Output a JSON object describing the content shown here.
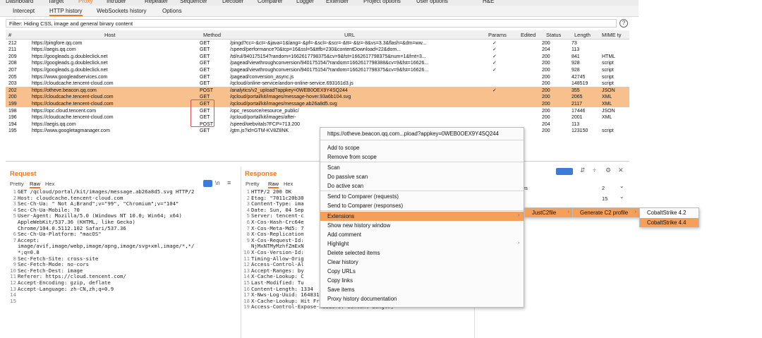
{
  "top_menu": [
    "Dashboard",
    "Target",
    "Proxy",
    "Intruder",
    "Repeater",
    "Sequencer",
    "Decoder",
    "Comparer",
    "Logger",
    "Extender",
    "Project options",
    "User options",
    "H&E"
  ],
  "sub_tabs": [
    "Intercept",
    "HTTP history",
    "WebSockets history",
    "Options"
  ],
  "filter_text": "Filter: Hiding CSS, image and general binary content",
  "help_glyph": "?",
  "columns": [
    "#",
    "Host",
    "Method",
    "URL",
    "Params",
    "Edited",
    "Status",
    "Length",
    "MIME ty"
  ],
  "rows": [
    {
      "n": "212",
      "host": "https://pingfore.qq.com",
      "method": "GET",
      "url": "/pingd?cc=-&ct=-&java=1&lang=-&pf=-&scl=-&scr=-&tt=-&tz=-8&vs=3.3&flash=&dm=ww...",
      "params": "✓",
      "status": "200",
      "length": "73",
      "mime": "",
      "hl": false
    },
    {
      "n": "211",
      "host": "https://aegis.qq.com",
      "method": "GET",
      "url": "/speed/performance?0&tcp=16&ssl=5&ttfb=230&contentDownload=22&dom...",
      "params": "✓",
      "status": "204",
      "length": "113",
      "mime": "",
      "hl": false
    },
    {
      "n": "209",
      "host": "https://googleads.g.doubleclick.net",
      "method": "GET",
      "url": "/td/rul/940175154?random=1662617798375&cv=9&fst=1662617798375&num=1&fmt=3...",
      "params": "✓",
      "status": "200",
      "length": "841",
      "mime": "HTML",
      "hl": false
    },
    {
      "n": "208",
      "host": "https://googleads.g.doubleclick.net",
      "method": "GET",
      "url": "/pagead/viewthroughconversion/940175154/?random=1662617798388&cv=9&fst=16626...",
      "params": "✓",
      "status": "200",
      "length": "928",
      "mime": "script",
      "hl": false
    },
    {
      "n": "207",
      "host": "https://googleads.g.doubleclick.net",
      "method": "GET",
      "url": "/pagead/viewthroughconversion/940175154/?random=1662617798375&cv=9&fst=16626...",
      "params": "✓",
      "status": "200",
      "length": "928",
      "mime": "script",
      "hl": false
    },
    {
      "n": "205",
      "host": "https://www.googleadservices.com",
      "method": "GET",
      "url": "/pagead/conversion_async.js",
      "params": "",
      "status": "200",
      "length": "42745",
      "mime": "script",
      "hl": false
    },
    {
      "n": "203",
      "host": "https://cloudcache.tencent-cloud.com",
      "method": "GET",
      "url": "/qcloud/online-service/andon-online-service.693161d3.js",
      "params": "",
      "status": "200",
      "length": "148519",
      "mime": "script",
      "hl": false
    },
    {
      "n": "202",
      "host": "https://otheve.beacon.qq.com",
      "method": "POST",
      "url": "/analytics/v2_upload?appkey=0WEB0OEX9Y4SQ244",
      "params": "✓",
      "status": "200",
      "length": "355",
      "mime": "JSON",
      "hl": true
    },
    {
      "n": "200",
      "host": "https://cloudcache.tencent-cloud.com",
      "method": "GET",
      "url": "/qcloud/portal/kit/images/message-hover.93a6b104.svg",
      "params": "",
      "status": "200",
      "length": "2065",
      "mime": "XML",
      "hl": true
    },
    {
      "n": "199",
      "host": "https://cloudcache.tencent-cloud.com",
      "method": "GET",
      "url": "/qcloud/portal/kit/images/message.ab26a8d5.svg",
      "params": "",
      "status": "200",
      "length": "2117",
      "mime": "XML",
      "hl": true
    },
    {
      "n": "198",
      "host": "https://opc.cloud.tencent.com",
      "method": "GET",
      "url": "/opc_resource/resource_public/",
      "params": "",
      "status": "200",
      "length": "17446",
      "mime": "JSON",
      "hl": false
    },
    {
      "n": "196",
      "host": "https://cloudcache.tencent-cloud.com",
      "method": "GET",
      "url": "/qcloud/portal/kit/images/after-",
      "params": "",
      "status": "200",
      "length": "2001",
      "mime": "XML",
      "hl": false
    },
    {
      "n": "194",
      "host": "https://aegis.qq.com",
      "method": "POST",
      "url": "/speed/webvitals?FCP=713.200",
      "params": "",
      "status": "204",
      "length": "113",
      "mime": "",
      "hl": false
    },
    {
      "n": "195",
      "host": "https://www.googletagmanager.com",
      "method": "GET",
      "url": "/gtm.js?id=GTM-KV8Z8NK",
      "params": "",
      "status": "200",
      "length": "123150",
      "mime": "script",
      "hl": false
    }
  ],
  "request": {
    "title": "Request",
    "tabs": [
      "Pretty",
      "Raw",
      "Hex"
    ],
    "toolbar": [
      "\\n",
      "≡"
    ],
    "lines": [
      [
        "1",
        "GET /qcloud/portal/kit/images/message.ab26a8d5.svg HTTP/2"
      ],
      [
        "2",
        "Host: cloudcache.tencent-cloud.com"
      ],
      [
        "3",
        "Sec-Ch-Ua: \" Not A;Brand\";v=\"99\", \"Chromium\";v=\"104\""
      ],
      [
        "4",
        "Sec-Ch-Ua-Mobile: ?0"
      ],
      [
        "5",
        "User-Agent: Mozilla/5.0 (Windows NT 10.0; Win64; x64)"
      ],
      [
        "",
        "AppleWebKit/537.36 (KHTML, like Gecko)"
      ],
      [
        "",
        "Chrome/104.0.5112.102 Safari/537.36"
      ],
      [
        "6",
        "Sec-Ch-Ua-Platform: \"macOS\""
      ],
      [
        "7",
        "Accept:"
      ],
      [
        "",
        "image/avif,image/webp,image/apng,image/svg+xml,image/*,*/"
      ],
      [
        "",
        "*;q=0.8"
      ],
      [
        "8",
        "Sec-Fetch-Site: cross-site"
      ],
      [
        "9",
        "Sec-Fetch-Mode: no-cors"
      ],
      [
        "10",
        "Sec-Fetch-Dest: image"
      ],
      [
        "11",
        "Referer: https://cloud.tencent.com/"
      ],
      [
        "12",
        "Accept-Encoding: gzip, deflate"
      ],
      [
        "13",
        "Accept-Language: zh-CN,zh;q=0.9"
      ],
      [
        "14",
        ""
      ],
      [
        "15",
        ""
      ]
    ]
  },
  "response": {
    "title": "Response",
    "tabs": [
      "Pretty",
      "Raw",
      "Hex"
    ],
    "lines": [
      [
        "1",
        "HTTP/2 200 OK"
      ],
      [
        "2",
        "Etag: \"7011c20b30"
      ],
      [
        "3",
        "Content-Type: ima"
      ],
      [
        "4",
        "Date: Sun, 04 Sep"
      ],
      [
        "5",
        "Server: tencent-c"
      ],
      [
        "6",
        "X-Cos-Hash-Crc64e"
      ],
      [
        "7",
        "X-Cos-Meta-Md5: 7"
      ],
      [
        "8",
        "X-Cos-Replication"
      ],
      [
        "9",
        "X-Cos-Request-Id:"
      ],
      [
        "",
        "NjMxNTMyMzhfZmExN"
      ],
      [
        "10",
        "X-Cos-Version-Id:"
      ],
      [
        "11",
        "Timing-Allow-Orig"
      ],
      [
        "12",
        "Access-Control-Al"
      ],
      [
        "13",
        "Accept-Ranges: by"
      ],
      [
        "14",
        "X-Cache-Lookup: C"
      ],
      [
        "15",
        "Last-Modified: Tu"
      ],
      [
        "16",
        "Content-Length: 1334"
      ],
      [
        "17",
        "X-Nws-Log-Uuid: 16483175132883555382"
      ],
      [
        "18",
        "X-Cache-Lookup: Hit From Inner Cluster"
      ],
      [
        "19",
        "Access-Control-Expose-Headers: Content-Length,"
      ]
    ]
  },
  "inspector": {
    "items": [
      {
        "label": "es",
        "count": "2"
      },
      {
        "label": "",
        "count": "15"
      },
      {
        "label": "ers",
        "count": "19"
      }
    ],
    "icons": [
      "⊞",
      "☰",
      "⚙",
      "✕"
    ]
  },
  "context_menu": {
    "header": "https://otheve.beacon.qq.com...pload?appkey=0WEB0OEX9Y4SQ244",
    "items": [
      "Add to scope",
      "Remove from scope",
      "Scan",
      "Do passive scan",
      "Do active scan",
      "Send to Comparer (requests)",
      "Send to Comparer (responses)",
      "Extensions",
      "Show new history window",
      "Add comment",
      "Highlight",
      "Delete selected items",
      "Clear history",
      "Copy URLs",
      "Copy links",
      "Save items",
      "Proxy history documentation"
    ],
    "submenu1": [
      "JustC2file"
    ],
    "submenu2": [
      "Generate C2 profile"
    ],
    "submenu3": [
      "CobaltStrike 4.2",
      "CobaltStrike 4.4"
    ]
  },
  "colors": {
    "accent": "#e8782a",
    "highlight_row": "#f7c08d",
    "menu_active": "#f5a05a",
    "method_box": "#e05050"
  }
}
